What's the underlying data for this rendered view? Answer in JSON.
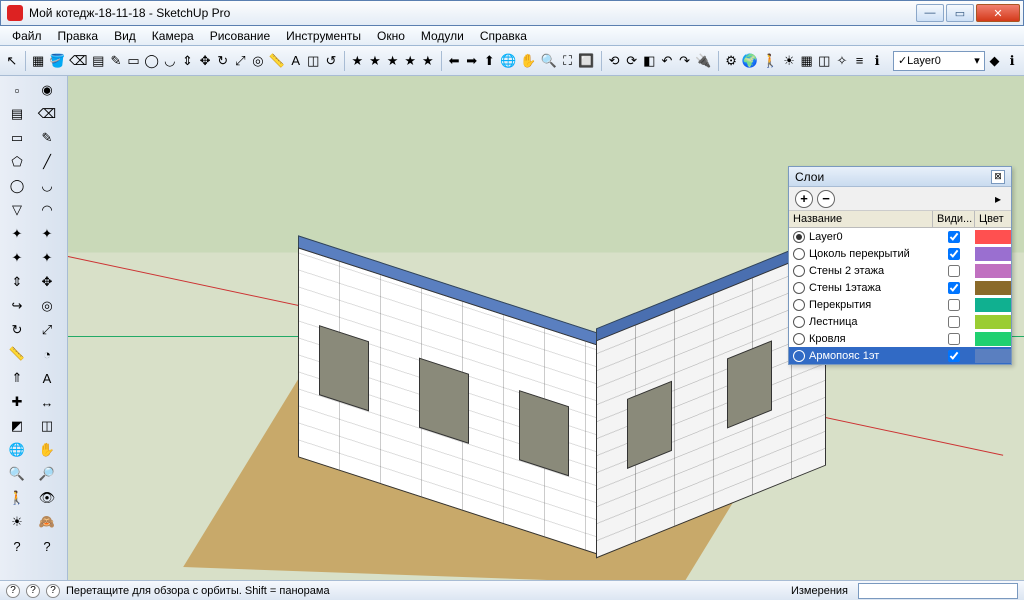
{
  "window": {
    "title": "Мой котедж-18-11-18 - SketchUp Pro"
  },
  "menu": [
    "Файл",
    "Правка",
    "Вид",
    "Камера",
    "Рисование",
    "Инструменты",
    "Окно",
    "Модули",
    "Справка"
  ],
  "top_toolbar_icons": [
    "cursor",
    "component",
    "paint",
    "eraser",
    "brick",
    "pencil",
    "rect",
    "circle",
    "arc",
    "pushpull",
    "move",
    "rotate",
    "scale",
    "offset",
    "tape",
    "text",
    "plane",
    "refresh",
    "star1",
    "star2",
    "star3",
    "star4",
    "star5",
    "arrow-l",
    "arrow-r",
    "arrow-u",
    "orbit",
    "pan",
    "zoom",
    "zoom-ext",
    "zoom-win",
    "prev",
    "next",
    "iso",
    "undo",
    "redo",
    "plug1",
    "plug2",
    "earth",
    "walk",
    "light",
    "grid",
    "group",
    "explode",
    "layer",
    "info"
  ],
  "layer_selector": {
    "value": "Layer0",
    "checked": true
  },
  "palette_icons": [
    "select",
    "lasso",
    "brick",
    "eraser",
    "rect",
    "pencil",
    "poly",
    "line",
    "circle",
    "arc",
    "triangle",
    "arc2",
    "star-a",
    "star-b",
    "star-c",
    "star-d",
    "pushpull",
    "move",
    "followme",
    "offset",
    "rotate",
    "scale",
    "tape",
    "protractor",
    "extrude",
    "text",
    "axes",
    "dim",
    "section",
    "plane",
    "orbit",
    "pan",
    "zoom",
    "zoom-w",
    "walk",
    "look",
    "light",
    "hide",
    "q1",
    "q2"
  ],
  "panel": {
    "title": "Слои",
    "add_label": "+",
    "remove_label": "−",
    "menu_label": "▸",
    "columns": {
      "name": "Название",
      "visible": "Види...",
      "color": "Цвет"
    },
    "layers": [
      {
        "name": "Layer0",
        "active": true,
        "visible": true,
        "color": "#ff5050"
      },
      {
        "name": "Цоколь перекрытий",
        "active": false,
        "visible": true,
        "color": "#9a6fd0"
      },
      {
        "name": "Стены 2 этажа",
        "active": false,
        "visible": false,
        "color": "#c070c0"
      },
      {
        "name": "Стены 1этажа",
        "active": false,
        "visible": true,
        "color": "#8a6a2a"
      },
      {
        "name": "Перекрытия",
        "active": false,
        "visible": false,
        "color": "#10b090"
      },
      {
        "name": "Лестница",
        "active": false,
        "visible": false,
        "color": "#9acd32"
      },
      {
        "name": "Кровля",
        "active": false,
        "visible": false,
        "color": "#20d070"
      },
      {
        "name": "Армопояс 1эт",
        "active": false,
        "visible": true,
        "color": "#5a7fc0",
        "selected": true
      }
    ]
  },
  "status": {
    "hint": "Перетащите для обзора с орбиты.  Shift = панорама",
    "measurement_label": "Измерения"
  }
}
